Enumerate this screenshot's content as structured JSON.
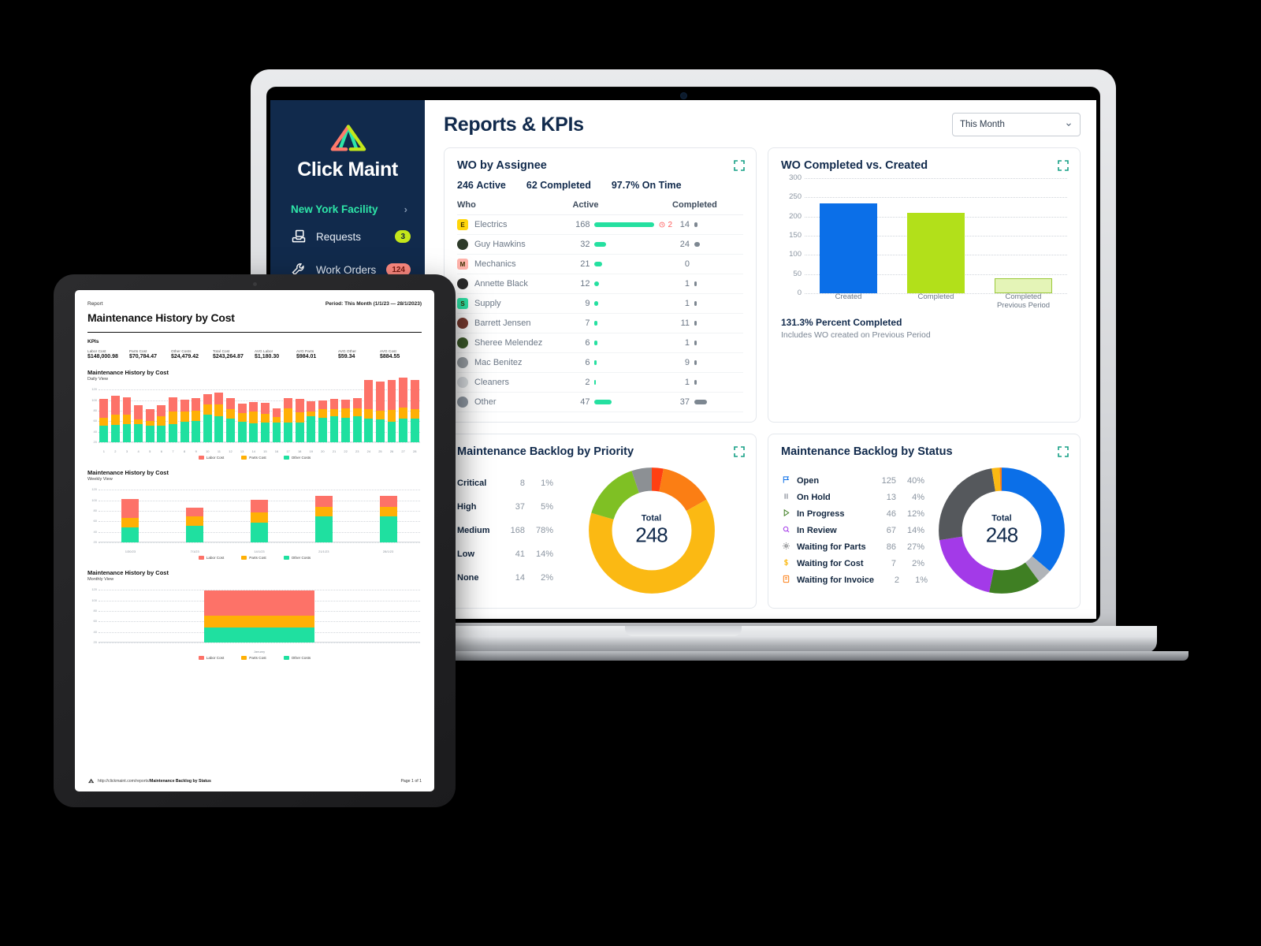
{
  "laptop": {
    "sidebar": {
      "brand_name": "Click Maint",
      "facility": "New York Facility",
      "items": [
        {
          "label": "Requests",
          "badge": "3",
          "icon": "requests-icon"
        },
        {
          "label": "Work Orders",
          "badge": "124",
          "icon": "wrench-icon"
        }
      ]
    },
    "header": {
      "title": "Reports & KPIs",
      "period_value": "This Month"
    },
    "cards": {
      "assignee": {
        "title": "WO by Assignee",
        "stats": [
          {
            "value": "246",
            "label": "Active"
          },
          {
            "value": "62",
            "label": "Completed"
          },
          {
            "value": "97.7%",
            "label": "On Time"
          }
        ],
        "columns": [
          "Who",
          "Active",
          "Completed"
        ],
        "rows": [
          {
            "who": "Electrics",
            "initial": "E",
            "avatar_type": "square",
            "avatar_color": "#ffd60a",
            "active": "168",
            "active_w": 76,
            "completed": "14",
            "completed_w": 4,
            "alert": "2"
          },
          {
            "who": "Guy Hawkins",
            "initial": "",
            "avatar_type": "photo",
            "avatar_color": "#2e3b2a",
            "active": "32",
            "active_w": 15,
            "completed": "24",
            "completed_w": 7,
            "alert": ""
          },
          {
            "who": "Mechanics",
            "initial": "M",
            "avatar_type": "square",
            "avatar_color": "#ffb3ab",
            "active": "21",
            "active_w": 10,
            "completed": "0",
            "completed_w": 0,
            "alert": ""
          },
          {
            "who": "Annette Black",
            "initial": "",
            "avatar_type": "photo",
            "avatar_color": "#2a2a2a",
            "active": "12",
            "active_w": 6,
            "completed": "1",
            "completed_w": 3,
            "alert": ""
          },
          {
            "who": "Supply",
            "initial": "S",
            "avatar_type": "square",
            "avatar_color": "#2ee6a8",
            "active": "9",
            "active_w": 5,
            "completed": "1",
            "completed_w": 3,
            "alert": ""
          },
          {
            "who": "Barrett Jensen",
            "initial": "",
            "avatar_type": "photo",
            "avatar_color": "#7a3b30",
            "active": "7",
            "active_w": 4,
            "completed": "11",
            "completed_w": 3,
            "alert": ""
          },
          {
            "who": "Sheree Melendez",
            "initial": "",
            "avatar_type": "photo",
            "avatar_color": "#3d5b2a",
            "active": "6",
            "active_w": 4,
            "completed": "1",
            "completed_w": 3,
            "alert": ""
          },
          {
            "who": "Mac Benitez",
            "initial": "",
            "avatar_type": "photo",
            "avatar_color": "#9aa0a6",
            "active": "6",
            "active_w": 3,
            "completed": "9",
            "completed_w": 3,
            "alert": ""
          },
          {
            "who": "Cleaners",
            "initial": "",
            "avatar_type": "photo",
            "avatar_color": "#d9dde1",
            "active": "2",
            "active_w": 2,
            "completed": "1",
            "completed_w": 3,
            "alert": ""
          },
          {
            "who": "Other",
            "initial": "",
            "avatar_type": "photo",
            "avatar_color": "#8f98a3",
            "active": "47",
            "active_w": 22,
            "completed": "37",
            "completed_w": 16,
            "alert": ""
          }
        ]
      },
      "completed_vs_created": {
        "title": "WO Completed vs. Created",
        "percent_completed": "131.3% Percent Completed",
        "note": "Includes WO created on Previous Period"
      },
      "backlog_priority": {
        "title": "Maintenance Backlog by Priority",
        "total_label": "Total",
        "total_value": "248"
      },
      "backlog_status": {
        "title": "Maintenance Backlog by Status",
        "total_label": "Total",
        "total_value": "248"
      }
    }
  },
  "tablet": {
    "report": {
      "kicker": "Report",
      "period": "Period: This Month (1/1/23 — 28/1/2023)",
      "title": "Maintenance History by Cost",
      "kpi_heading": "KPIs",
      "kpis": [
        {
          "label": "Labor Cost",
          "value": "$148,000.98"
        },
        {
          "label": "Parts Cost",
          "value": "$70,784.47"
        },
        {
          "label": "Other Costs",
          "value": "$24,479.42"
        },
        {
          "label": "Total Cost",
          "value": "$243,264.87"
        },
        {
          "label": "AVG Labor",
          "value": "$1,180.30"
        },
        {
          "label": "AVG Parts",
          "value": "$984.01"
        },
        {
          "label": "AVG Other",
          "value": "$59.34"
        },
        {
          "label": "AVG Cost",
          "value": "$884.55"
        }
      ],
      "blocks": [
        {
          "title": "Maintenance History by Cost",
          "subtitle": "Daily View"
        },
        {
          "title": "Maintenance History by Cost",
          "subtitle": "Weekly View"
        },
        {
          "title": "Maintenance History by Cost",
          "subtitle": "Monthly View"
        }
      ],
      "legend": [
        {
          "name": "Labor Cost",
          "color": "#fd7268"
        },
        {
          "name": "Parts Cost",
          "color": "#ffb005"
        },
        {
          "name": "Other Costs",
          "color": "#1fe0a0"
        }
      ],
      "footer": {
        "url_prefix": "http://clickmaint.com/reports/",
        "url_bold": "Maintenance Backlog by Status",
        "page": "Page 1 of 1"
      }
    }
  },
  "chart_data": [
    {
      "type": "bar",
      "title": "WO Completed vs. Created",
      "categories": [
        "Created",
        "Completed",
        "Completed Previous Period"
      ],
      "values": [
        235,
        210,
        40
      ],
      "colors": [
        "#0b6fe8",
        "#b2e01a",
        "#e4f4b7"
      ],
      "ylabel": "",
      "xlabel": "",
      "yticks": [
        0,
        50,
        100,
        150,
        200,
        250,
        300
      ],
      "ylim": [
        0,
        300
      ],
      "grid": true,
      "annotations": [
        "131.3% Percent Completed",
        "Includes WO created on Previous Period"
      ]
    },
    {
      "type": "pie",
      "title": "Maintenance Backlog by Priority",
      "total": 248,
      "labels": [
        "Critical",
        "High",
        "Medium",
        "Low",
        "None"
      ],
      "values": [
        8,
        37,
        168,
        41,
        14
      ],
      "percents": [
        "1%",
        "5%",
        "78%",
        "14%",
        "2%"
      ],
      "colors": [
        "#ff4013",
        "#fb7e14",
        "#fbb913",
        "#7fc024",
        "#8c9094"
      ],
      "legend": "left"
    },
    {
      "type": "pie",
      "title": "Maintenance Backlog by Status",
      "total": 248,
      "labels": [
        "Open",
        "On Hold",
        "In Progress",
        "In Review",
        "Waiting for Parts",
        "Waiting for Cost",
        "Waiting for Invoice"
      ],
      "values": [
        125,
        13,
        46,
        67,
        86,
        7,
        2
      ],
      "percents": [
        "40%",
        "4%",
        "12%",
        "14%",
        "27%",
        "2%",
        "1%"
      ],
      "colors": [
        "#0b6fe8",
        "#b0b4b8",
        "#3f7f23",
        "#a33ae8",
        "#55585c",
        "#fbb913",
        "#fb7e14"
      ],
      "icons": [
        "flag-icon",
        "pause-icon",
        "play-icon",
        "search-icon",
        "gear-icon",
        "dollar-icon",
        "invoice-icon"
      ],
      "legend": "left"
    },
    {
      "type": "bar",
      "title": "Maintenance History by Cost",
      "subtitle": "Daily View",
      "stacked": true,
      "categories": [
        "1",
        "2",
        "3",
        "4",
        "5",
        "6",
        "7",
        "8",
        "9",
        "10",
        "11",
        "12",
        "13",
        "14",
        "15",
        "16",
        "17",
        "18",
        "19",
        "20",
        "21",
        "22",
        "23",
        "24",
        "25",
        "26",
        "27",
        "28"
      ],
      "series": [
        {
          "name": "Other Costs",
          "color": "#1fe0a0",
          "values": [
            32,
            33,
            35,
            34,
            31,
            31,
            35,
            39,
            41,
            53,
            50,
            45,
            39,
            36,
            38,
            38,
            38,
            38,
            50,
            47,
            50,
            47,
            50,
            45,
            43,
            39,
            45,
            45
          ]
        },
        {
          "name": "Parts Cost",
          "color": "#ffb005",
          "values": [
            15,
            19,
            17,
            10,
            9,
            19,
            24,
            20,
            19,
            19,
            22,
            18,
            16,
            23,
            16,
            10,
            27,
            19,
            8,
            16,
            13,
            17,
            14,
            18,
            17,
            22,
            21,
            18
          ]
        },
        {
          "name": "Labor Cost",
          "color": "#fd7268",
          "values": [
            35,
            36,
            34,
            26,
            23,
            20,
            27,
            22,
            24,
            20,
            22,
            21,
            19,
            18,
            21,
            17,
            19,
            25,
            20,
            17,
            19,
            17,
            20,
            55,
            56,
            58,
            57,
            55
          ]
        }
      ],
      "yticks": [
        20,
        40,
        60,
        80,
        100,
        120
      ],
      "ylim": [
        20,
        125
      ],
      "grid": true
    },
    {
      "type": "bar",
      "title": "Maintenance History by Cost",
      "subtitle": "Weekly View",
      "stacked": true,
      "categories": [
        "1/30/23",
        "7/1/23",
        "14/1/23",
        "21/1/23",
        "28/1/23"
      ],
      "series": [
        {
          "name": "Other Costs",
          "color": "#1fe0a0",
          "values": [
            29,
            31,
            38,
            49,
            49
          ]
        },
        {
          "name": "Parts Cost",
          "color": "#ffb005",
          "values": [
            18,
            18,
            19,
            18,
            18
          ]
        },
        {
          "name": "Labor Cost",
          "color": "#fd7268",
          "values": [
            36,
            17,
            24,
            22,
            22
          ]
        }
      ],
      "yticks": [
        20,
        40,
        60,
        80,
        100,
        120
      ],
      "ylim": [
        20,
        125
      ],
      "grid": true
    },
    {
      "type": "bar",
      "title": "Maintenance History by Cost",
      "subtitle": "Monthly View",
      "stacked": true,
      "categories": [
        "January"
      ],
      "series": [
        {
          "name": "Other Costs",
          "color": "#1fe0a0",
          "values": [
            29
          ]
        },
        {
          "name": "Parts Cost",
          "color": "#ffb005",
          "values": [
            22
          ]
        },
        {
          "name": "Labor Cost",
          "color": "#fd7268",
          "values": [
            48
          ]
        }
      ],
      "yticks": [
        20,
        40,
        60,
        80,
        100,
        120
      ],
      "ylim": [
        20,
        125
      ],
      "grid": true
    }
  ]
}
